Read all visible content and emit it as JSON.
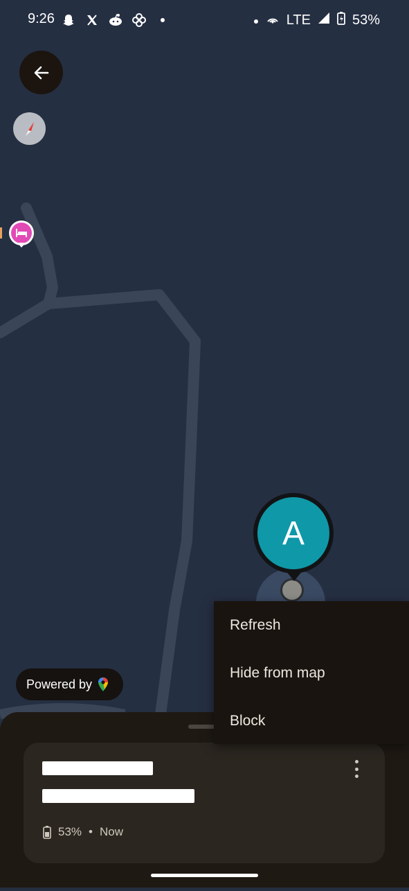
{
  "status_bar": {
    "time": "9:26",
    "network": "LTE",
    "battery": "53%",
    "left_icons": [
      "snapchat-icon",
      "x-icon",
      "reddit-icon",
      "pinwheel-icon",
      "dot-icon"
    ],
    "right_icons": [
      "dot-icon",
      "hotspot-icon",
      "signal-icon",
      "battery-charging-icon"
    ]
  },
  "map": {
    "back_icon": "arrow-left-icon",
    "compass_icon": "compass-icon",
    "hotel_icon": "bed-icon",
    "avatar_letter": "A",
    "powered_by": "Powered by",
    "maps_icon": "google-maps-pin-icon",
    "colors": {
      "map_bg": "#252f42",
      "road": "#3a4557",
      "avatar": "#0f98a8",
      "hotel": "#e24ab6"
    }
  },
  "menu": {
    "items": [
      {
        "label": "Refresh"
      },
      {
        "label": "Hide from map"
      },
      {
        "label": "Block"
      }
    ]
  },
  "card": {
    "battery": "53%",
    "separator": "•",
    "updated": "Now",
    "battery_icon": "battery-icon",
    "more_icon": "more-vertical-icon"
  }
}
